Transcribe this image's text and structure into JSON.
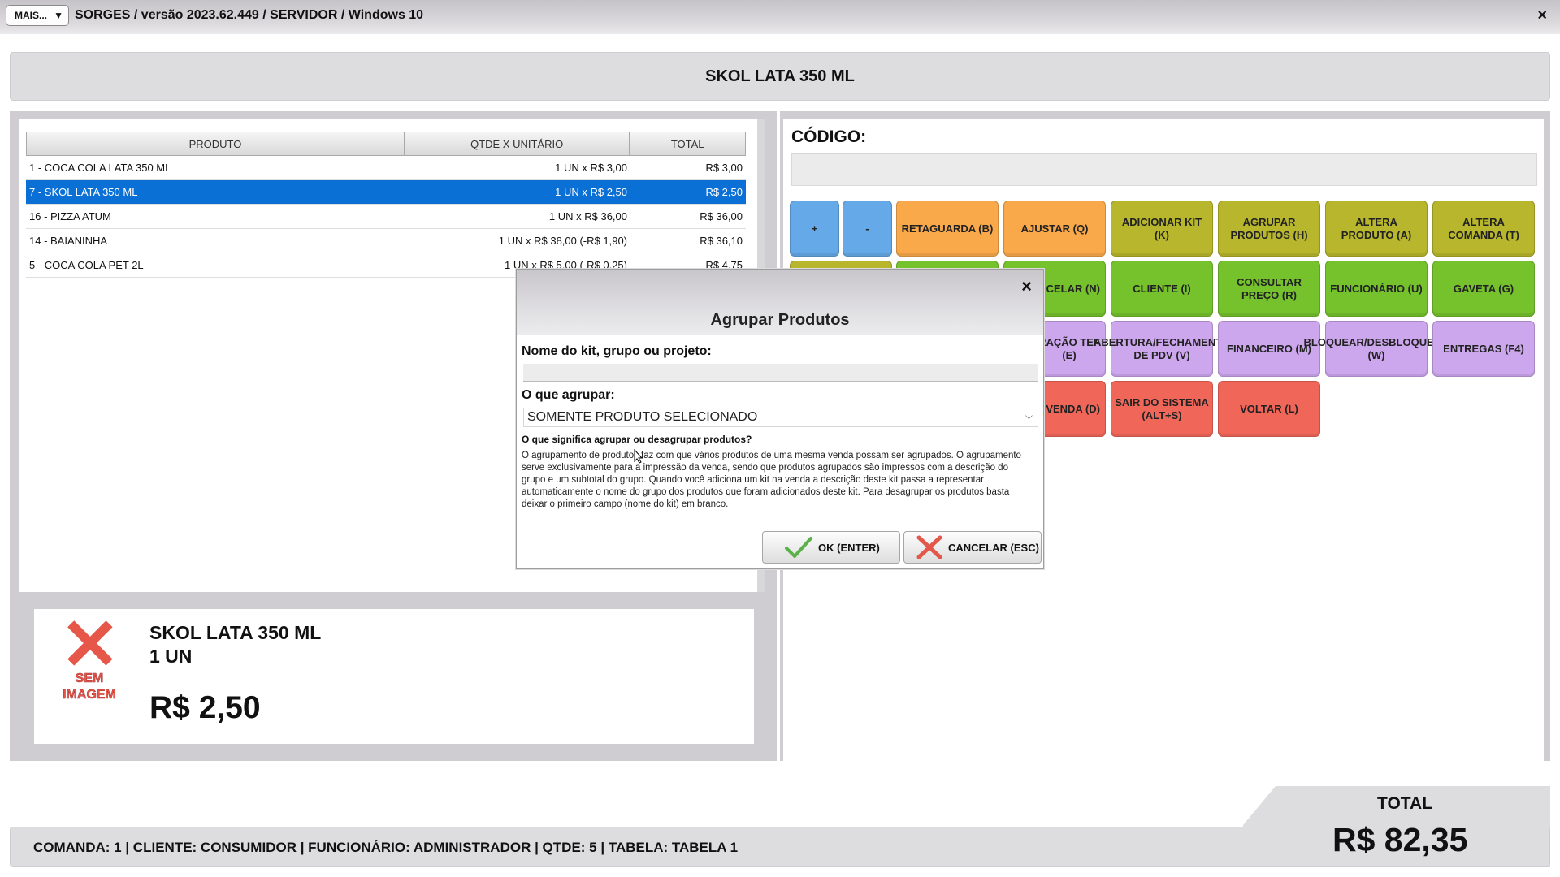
{
  "titlebar": {
    "mais_label": "MAIS...",
    "title": "SORGES / versão 2023.62.449 / SERVIDOR / Windows 10",
    "close": "×"
  },
  "banner": {
    "product": "SKOL LATA 350 ML"
  },
  "table": {
    "headers": [
      "PRODUTO",
      "QTDE X UNITÁRIO",
      "TOTAL"
    ],
    "rows": [
      {
        "produto": "1 - COCA COLA LATA 350 ML",
        "qtde": "1 UN x R$ 3,00",
        "total": "R$ 3,00"
      },
      {
        "produto": "7 - SKOL LATA 350 ML",
        "qtde": "1 UN x R$ 2,50",
        "total": "R$ 2,50"
      },
      {
        "produto": "16 - PIZZA ATUM",
        "qtde": "1 UN x R$ 36,00",
        "total": "R$ 36,00"
      },
      {
        "produto": "14 - BAIANINHA",
        "qtde": "1 UN x R$ 38,00 (-R$ 1,90)",
        "total": "R$ 36,10"
      },
      {
        "produto": "5 - COCA COLA PET 2L",
        "qtde": "1 UN x R$ 5,00 (-R$ 0,25)",
        "total": "R$ 4,75"
      }
    ]
  },
  "info": {
    "no_image": "SEM IMAGEM",
    "name": "SKOL LATA 350 ML",
    "qty": "1  UN",
    "price": "R$ 2,50"
  },
  "codigo": {
    "label": "CÓDIGO:"
  },
  "buttons": {
    "plus": "+",
    "minus": "-",
    "retaguarda": "RETAGUARDA (B)",
    "ajustar": "AJUSTAR (Q)",
    "adicionar_kit": "ADICIONAR KIT (K)",
    "agrupar": "AGRUPAR PRODUTOS (H)",
    "altera_produto": "ALTERA PRODUTO (A)",
    "altera_comanda": "ALTERA COMANDA (T)",
    "cancelar": "CELAR (N)",
    "cliente": "CLIENTE (I)",
    "consultar_preco": "CONSULTAR PREÇO (R)",
    "funcionario": "FUNCIONÁRIO (U)",
    "gaveta": "GAVETA (G)",
    "configuracao_tef": "RAÇÃO TEF (E)",
    "abertura": "ABERTURA/FECHAMENTO DE PDV (V)",
    "financeiro": "FINANCEIRO (M)",
    "bloquear": "BLOQUEAR/DESBLOQUEAR (W)",
    "entregas": "ENTREGAS (F4)",
    "venda": "VENDA (D)",
    "sair": "SAIR DO SISTEMA (ALT+S)",
    "voltar": "VOLTAR (L)"
  },
  "modal": {
    "close": "×",
    "title": "Agrupar Produtos",
    "label_nome": "Nome do kit, grupo ou projeto:",
    "nome_value": "",
    "label_agrupar": "O que agrupar:",
    "select_value": "SOMENTE PRODUTO SELECIONADO",
    "help_title": "O que significa agrupar ou desagrupar produtos?",
    "help_text": "O agrupamento de produtos faz com que vários produtos de uma mesma venda possam ser agrupados. O agrupamento serve exclusivamente para a impressão da venda, sendo que produtos agrupados são impressos com a descrição do grupo e um subtotal do grupo. Quando você adiciona um kit na venda a descrição deste kit passa a representar automaticamente o nome do grupo dos produtos que foram adicionados deste kit. Para desagrupar os produtos basta deixar o primeiro campo (nome do kit) em branco.",
    "ok": "OK (ENTER)",
    "cancel": "CANCELAR (ESC)"
  },
  "status": {
    "text": "COMANDA: 1  |  CLIENTE: CONSUMIDOR  |  FUNCIONÁRIO: ADMINISTRADOR  |  QTDE: 5  |  TABELA: TABELA 1"
  },
  "total": {
    "label": "TOTAL",
    "value": "R$ 82,35"
  },
  "colors": {
    "selection": "#0b70d6",
    "blue": "#65a9e8",
    "orange": "#f9a94a",
    "olive": "#b7b62c",
    "green": "#76c22c",
    "purple": "#cda7ed",
    "red": "#f0675a"
  }
}
